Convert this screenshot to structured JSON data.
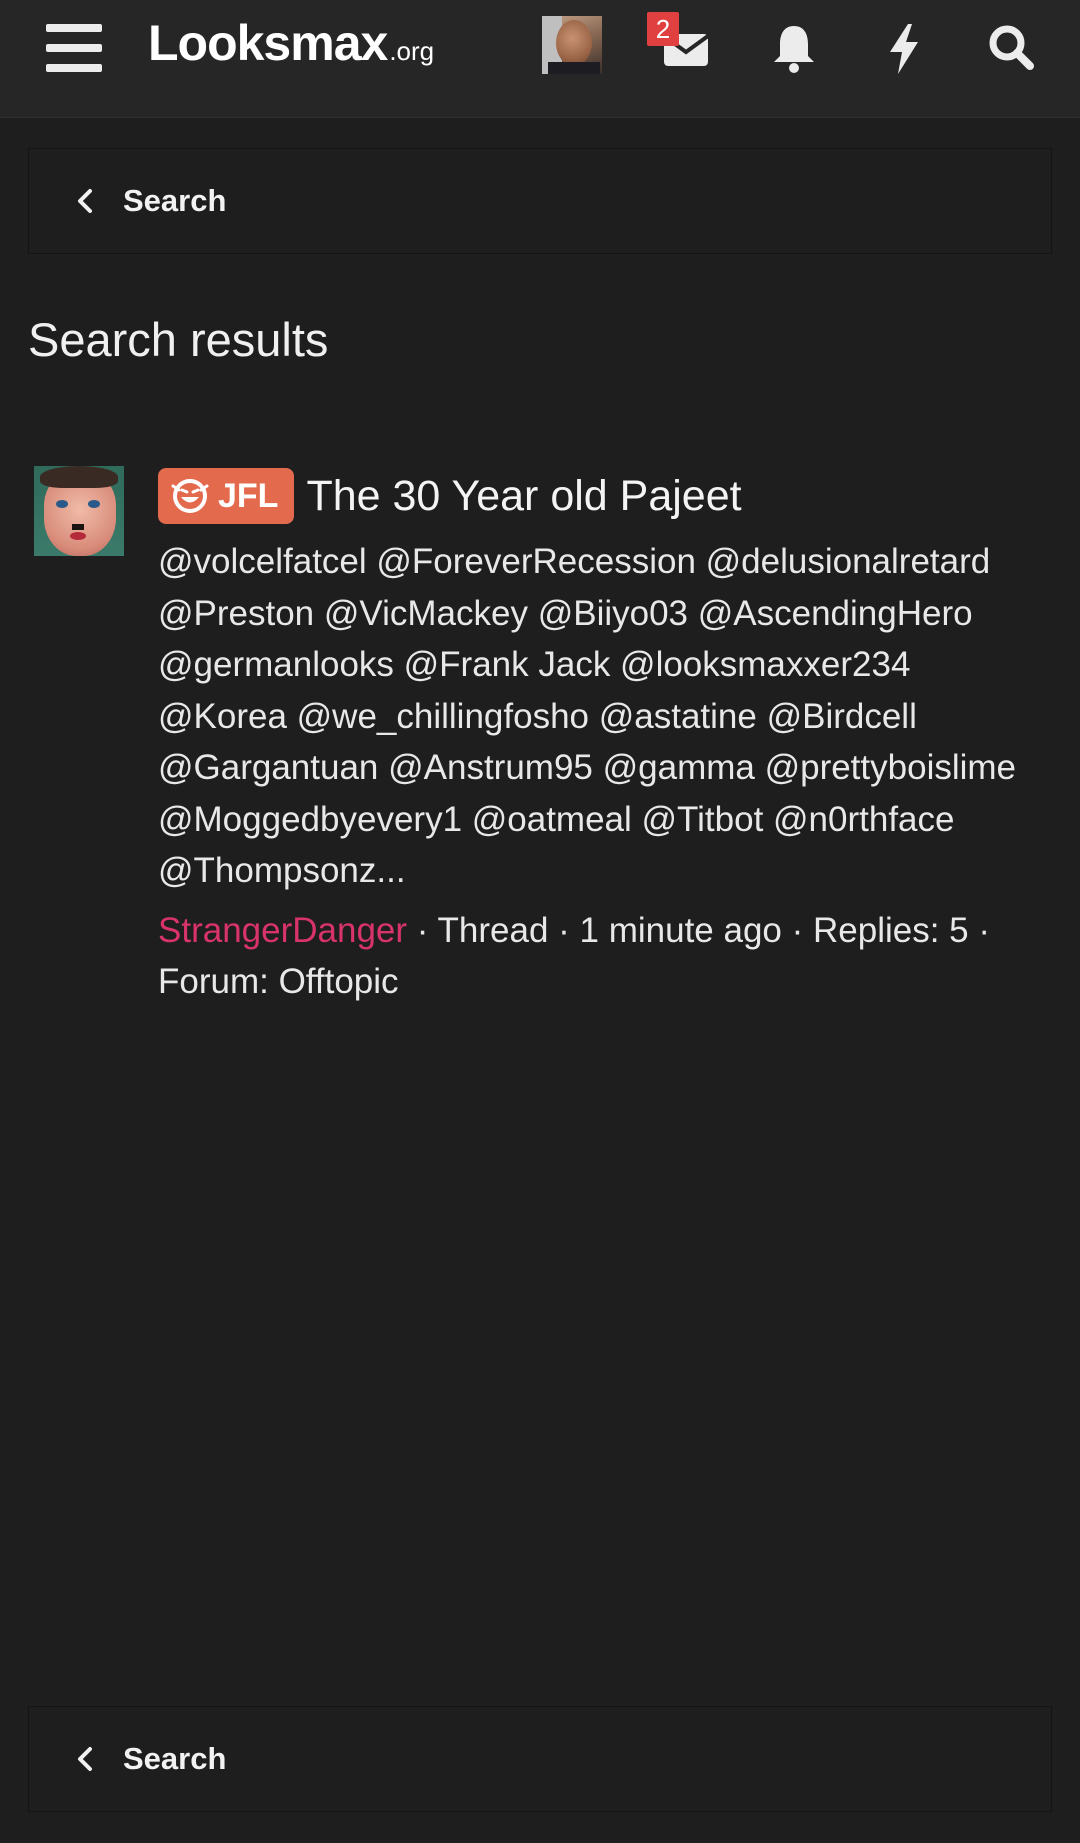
{
  "header": {
    "logo_main": "Looksmax",
    "logo_suffix": ".org",
    "inbox_count": "2",
    "icons": [
      "menu-icon",
      "avatar",
      "mail-icon",
      "bell-icon",
      "bolt-icon",
      "search-icon"
    ]
  },
  "breadcrumb_top": {
    "label": "Search"
  },
  "page": {
    "title": "Search results"
  },
  "result": {
    "prefix": "JFL",
    "title": "The 30 Year old Pajeet",
    "snippet_lines": [
      "@volcelfatcel @ForeverRecession @delusionalretard",
      "@Preston @VicMackey @Biiyo03 @AscendingHero",
      "@germanlooks @Frank Jack @looksmaxxer234",
      "@Korea @we_chillingfosho @astatine @Birdcell",
      "@Gargantuan @Anstrum95 @gamma @prettyboislime",
      "@Moggedbyevery1 @oatmeal @Titbot @n0rthface",
      "@Thompsonz..."
    ],
    "author": "StrangerDanger",
    "meta_rest_line1": " · Thread · 1 minute ago · Replies: 5 ·",
    "meta_line2": "Forum: Offtopic"
  },
  "breadcrumb_bottom": {
    "label": "Search"
  },
  "colors": {
    "background": "#1e1e1e",
    "topbar": "#262626",
    "prefix": "#e46a4e",
    "author": "#d8336a",
    "badge": "#e04040"
  }
}
